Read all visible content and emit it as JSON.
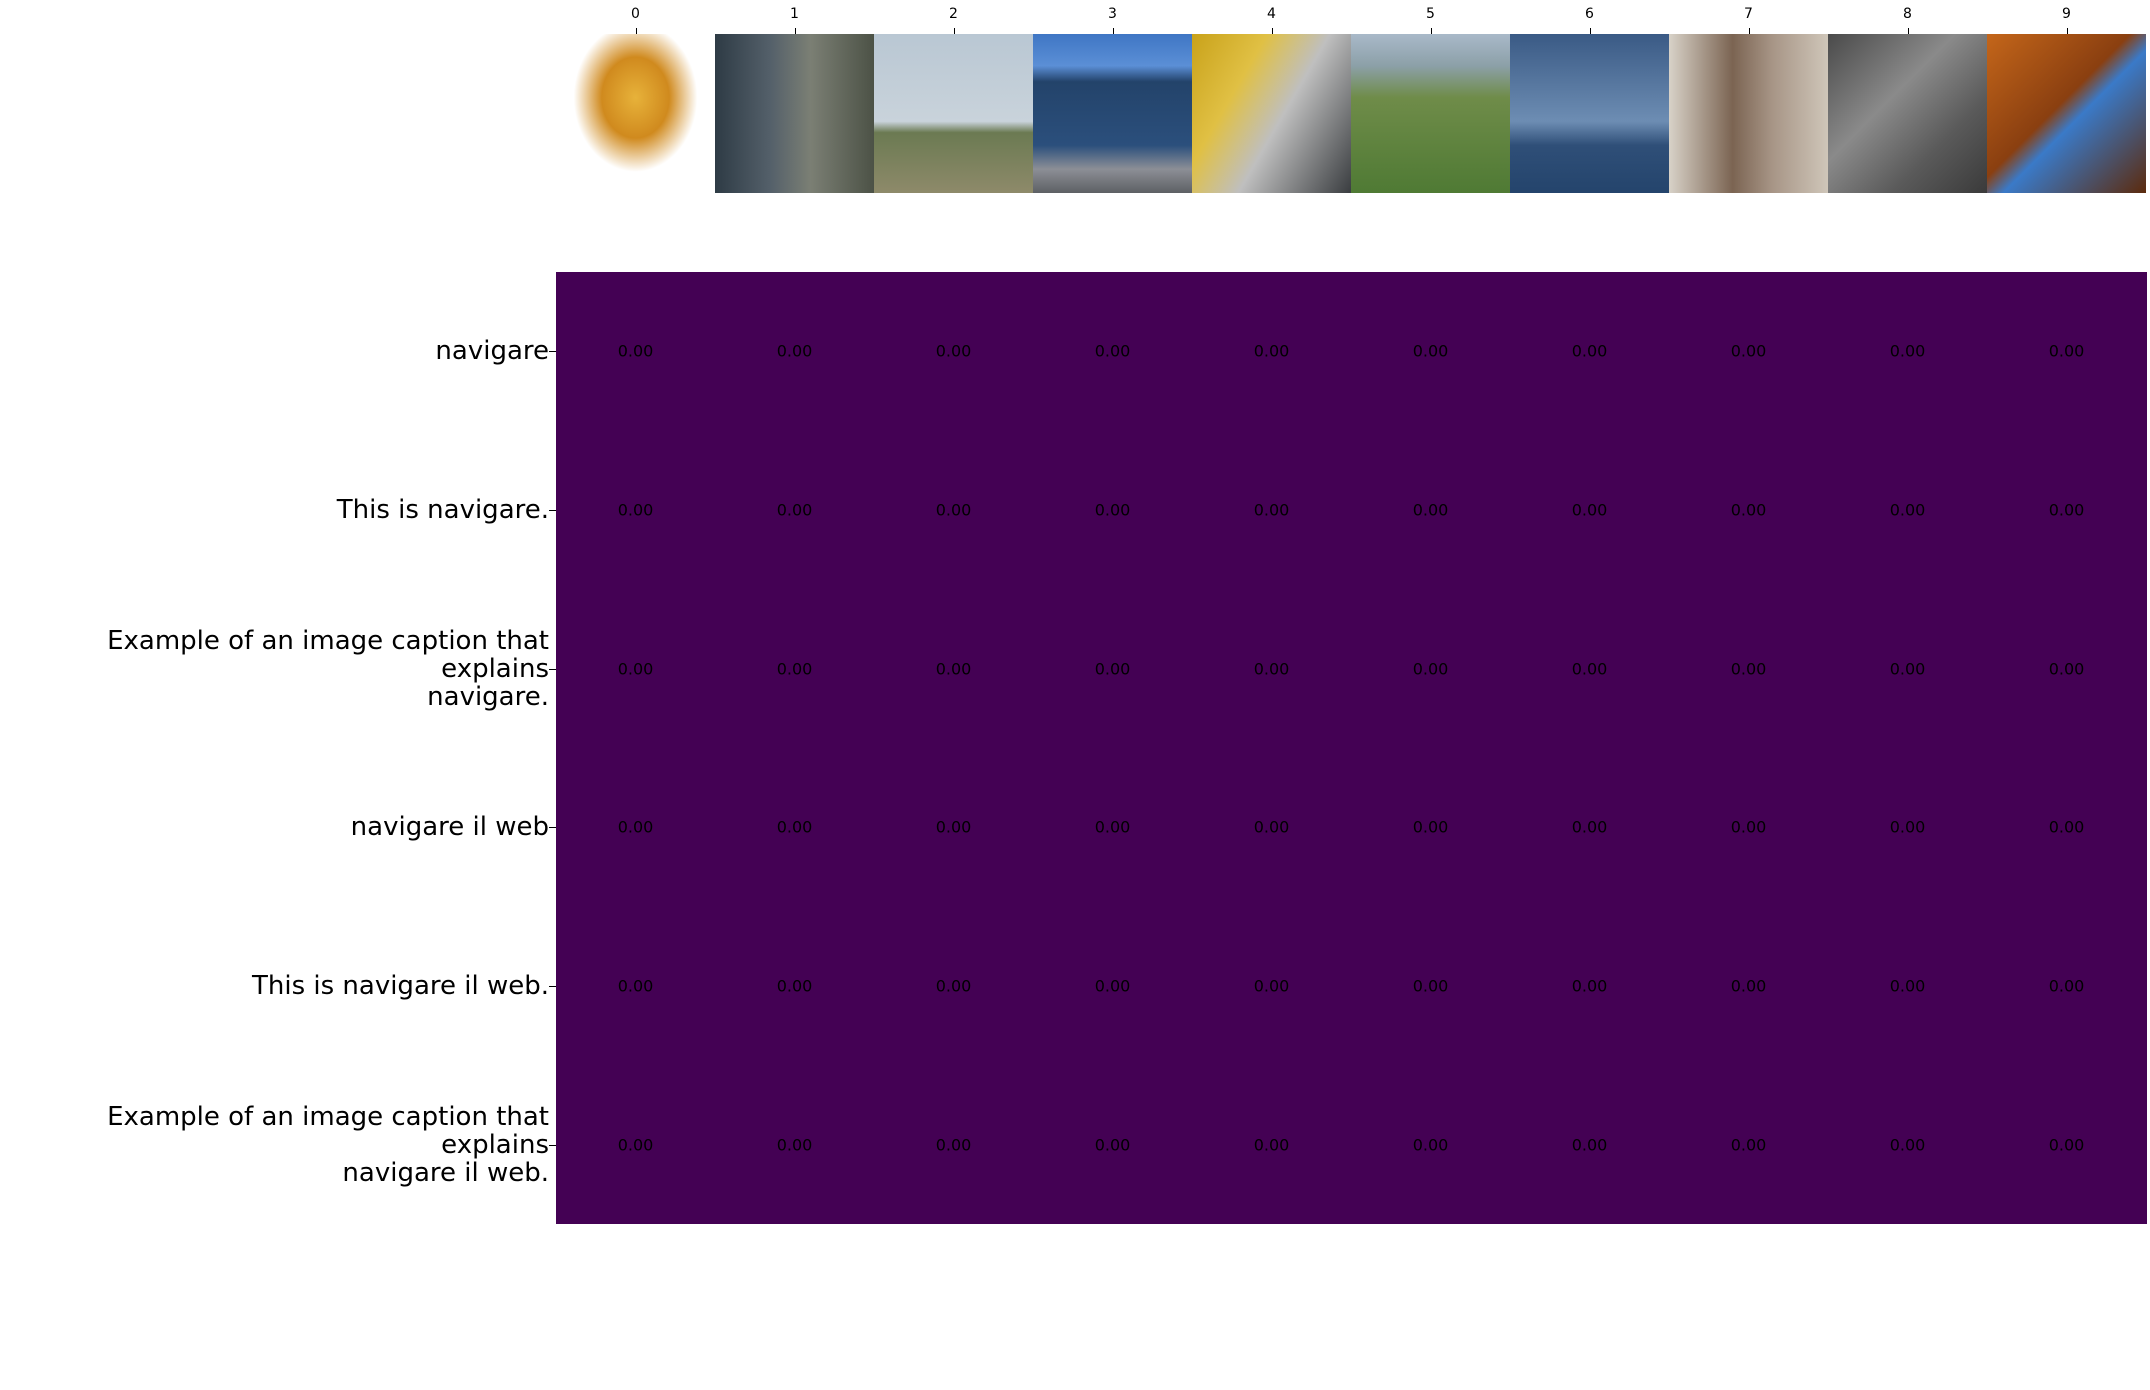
{
  "chart_data": {
    "type": "heatmap",
    "title": "",
    "xlabel": "",
    "ylabel": "",
    "columns": [
      "0",
      "1",
      "2",
      "3",
      "4",
      "5",
      "6",
      "7",
      "8",
      "9"
    ],
    "column_images": [
      "ornate golden deity figure on lotus",
      "airman at computer monitors",
      "grassy field with distant hill",
      "blue glass office building",
      "person leaning on yellow car",
      "aerial view of green fields",
      "two sailboats on water",
      "railway station platform",
      "carved stone coat of arms",
      "laptop on wooden desk"
    ],
    "rows": [
      "navigare",
      "This is navigare.",
      "Example of an image caption that explains\nnavigare.",
      "navigare il web",
      "This is navigare il web.",
      "Example of an image caption that explains\nnavigare il web."
    ],
    "values": [
      [
        0,
        0,
        0,
        0,
        0,
        0,
        0,
        0,
        0,
        0
      ],
      [
        0,
        0,
        0,
        0,
        0,
        0,
        0,
        0,
        0,
        0
      ],
      [
        0,
        0,
        0,
        0,
        0,
        0,
        0,
        0,
        0,
        0
      ],
      [
        0,
        0,
        0,
        0,
        0,
        0,
        0,
        0,
        0,
        0
      ],
      [
        0,
        0,
        0,
        0,
        0,
        0,
        0,
        0,
        0,
        0
      ],
      [
        0,
        0,
        0,
        0,
        0,
        0,
        0,
        0,
        0,
        0
      ]
    ],
    "value_labels": [
      [
        "0.00",
        "0.00",
        "0.00",
        "0.00",
        "0.00",
        "0.00",
        "0.00",
        "0.00",
        "0.00",
        "0.00"
      ],
      [
        "0.00",
        "0.00",
        "0.00",
        "0.00",
        "0.00",
        "0.00",
        "0.00",
        "0.00",
        "0.00",
        "0.00"
      ],
      [
        "0.00",
        "0.00",
        "0.00",
        "0.00",
        "0.00",
        "0.00",
        "0.00",
        "0.00",
        "0.00",
        "0.00"
      ],
      [
        "0.00",
        "0.00",
        "0.00",
        "0.00",
        "0.00",
        "0.00",
        "0.00",
        "0.00",
        "0.00",
        "0.00"
      ],
      [
        "0.00",
        "0.00",
        "0.00",
        "0.00",
        "0.00",
        "0.00",
        "0.00",
        "0.00",
        "0.00",
        "0.00"
      ],
      [
        "0.00",
        "0.00",
        "0.00",
        "0.00",
        "0.00",
        "0.00",
        "0.00",
        "0.00",
        "0.00",
        "0.00"
      ]
    ],
    "colormap": "viridis",
    "cell_color": "#440154",
    "grid": false
  }
}
